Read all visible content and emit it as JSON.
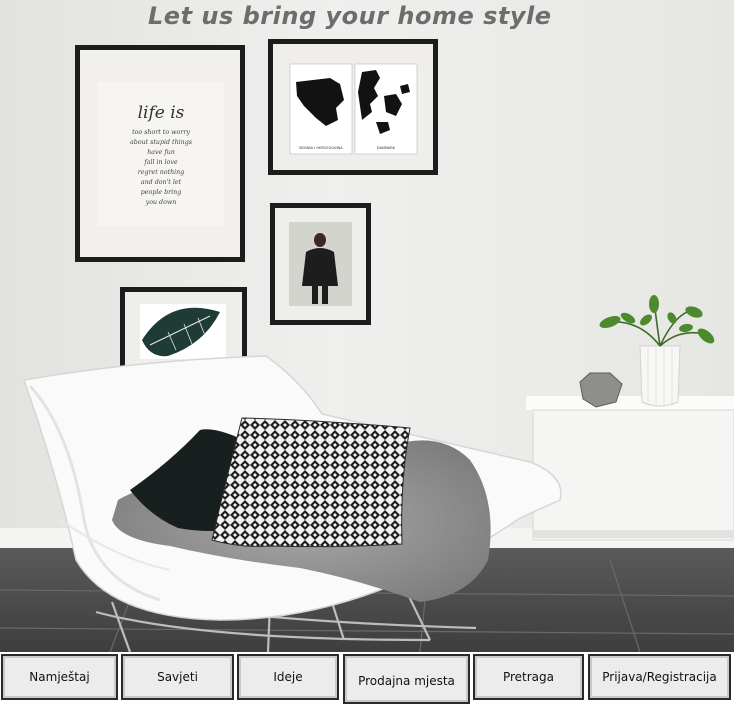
{
  "hero": {
    "tagline": "Let us bring your home style",
    "frames": {
      "poem_title": "life is",
      "poem_lines": [
        "too short to worry",
        "about stupid things",
        "have fun",
        "fall in love",
        "regret nothing",
        "and don't let",
        "people bring",
        "you down"
      ],
      "map_left_caption": "BOSNIA I HERCEGOVINA",
      "map_right_caption": "DANMARK"
    }
  },
  "nav": {
    "items": [
      "Namještaj",
      "Savjeti",
      "Ideje",
      "Prodajna mjesta",
      "Pretraga",
      "Prijava/Registracija"
    ]
  },
  "colors": {
    "wall": "#ebebe9",
    "floor": "#4d4d4d",
    "frame": "#1c1c1c",
    "tagline": "#6d6d6d",
    "button_bg": "#ececec",
    "button_border": "#2a2a2a"
  }
}
